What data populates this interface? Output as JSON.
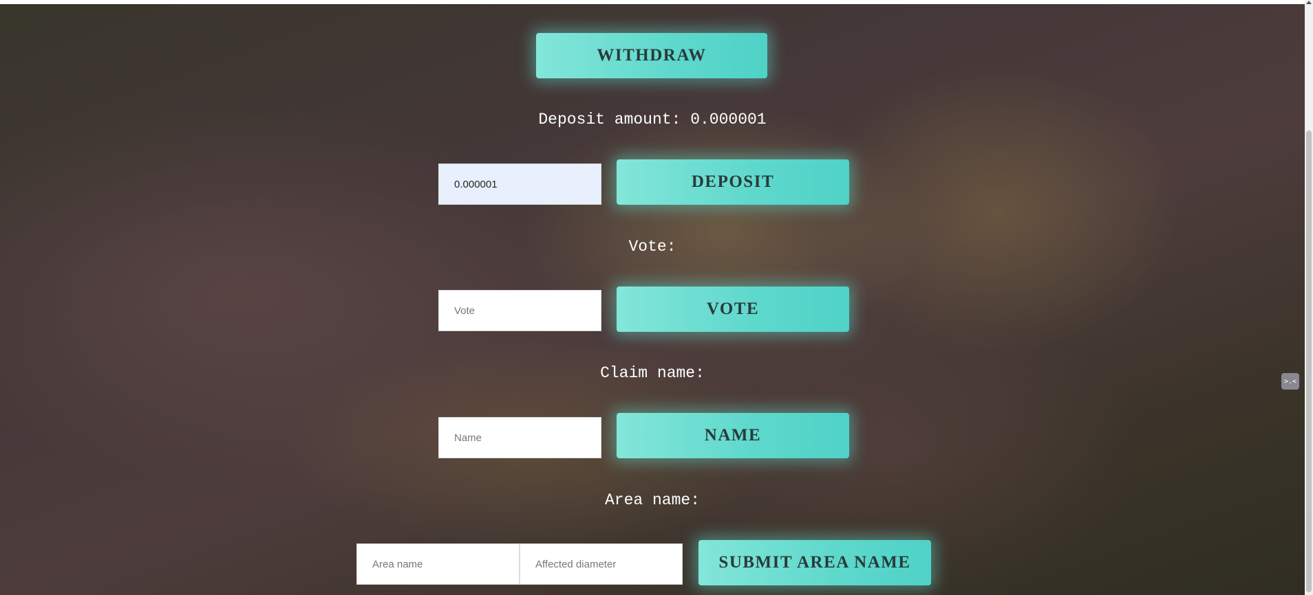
{
  "withdraw": {
    "label": "WITHDRAW"
  },
  "deposit": {
    "amount_text": "Deposit amount: 0.000001",
    "input_value": "0.000001",
    "button_label": "DEPOSIT"
  },
  "vote": {
    "heading": "Vote:",
    "placeholder": "Vote",
    "button_label": "VOTE"
  },
  "claim": {
    "heading": "Claim name:",
    "placeholder": "Name",
    "button_label": "NAME"
  },
  "area": {
    "heading": "Area name:",
    "name_placeholder": "Area name",
    "diameter_placeholder": "Affected diameter",
    "button_label": "SUBMIT AREA NAME"
  },
  "side_widget": {
    "icon": "collapse-arrows-icon",
    "glyph": ">.<"
  },
  "colors": {
    "button_accent": "#5ed8cc",
    "button_text": "#2a3a3a",
    "label_text": "#ffffff"
  }
}
